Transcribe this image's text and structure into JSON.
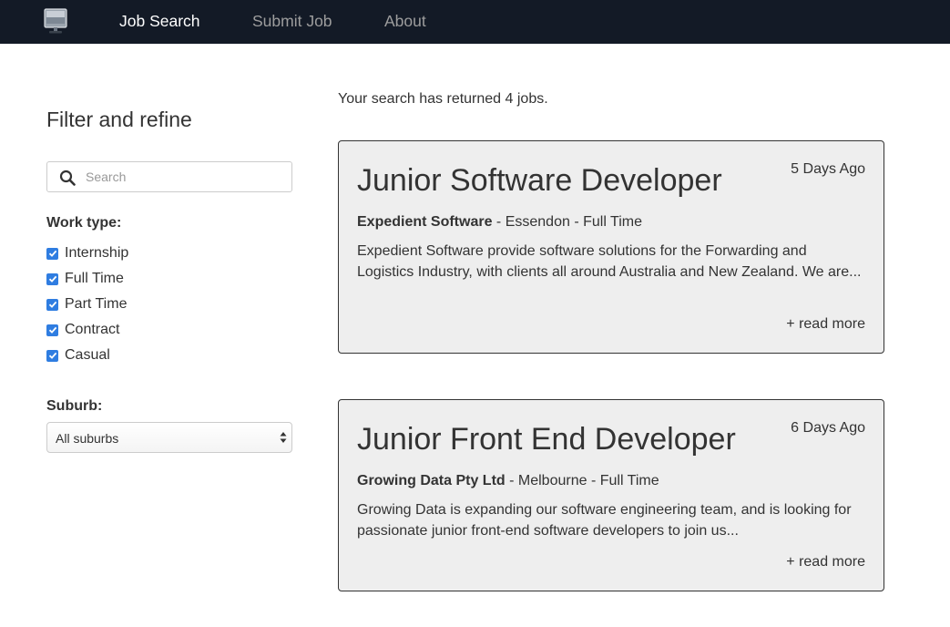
{
  "nav": {
    "logo_icon": "monitor-icon",
    "items": [
      {
        "label": "Job Search",
        "active": true
      },
      {
        "label": "Submit Job",
        "active": false
      },
      {
        "label": "About",
        "active": false
      }
    ]
  },
  "sidebar": {
    "title": "Filter and refine",
    "search": {
      "placeholder": "Search",
      "value": "",
      "icon": "search-icon"
    },
    "work_type": {
      "label": "Work type:",
      "options": [
        {
          "label": "Internship",
          "checked": true
        },
        {
          "label": "Full Time",
          "checked": true
        },
        {
          "label": "Part Time",
          "checked": true
        },
        {
          "label": "Contract",
          "checked": true
        },
        {
          "label": "Casual",
          "checked": true
        }
      ]
    },
    "suburb": {
      "label": "Suburb:",
      "selected": "All suburbs"
    }
  },
  "results": {
    "summary": "Your search has returned 4 jobs.",
    "jobs": [
      {
        "title": "Junior Software Developer",
        "posted": "5 Days Ago",
        "company": "Expedient Software",
        "details": " - Essendon - Full Time",
        "description": "Expedient Software provide software solutions for the Forwarding and Logistics Industry, with clients all around Australia and New Zealand. We are...",
        "read_more": "+ read more"
      },
      {
        "title": "Junior Front End Developer",
        "posted": "6 Days Ago",
        "company": "Growing Data Pty Ltd",
        "details": " - Melbourne - Full Time",
        "description": "Growing Data is expanding our software engineering team, and is looking for passionate junior front-end software developers to join us...",
        "read_more": "+ read more"
      }
    ]
  },
  "colors": {
    "navbar_bg": "#131a26",
    "nav_active": "#ffffff",
    "nav_inactive": "#9d9d9d",
    "card_bg": "#eeeeee",
    "checkbox": "#2f7de1"
  }
}
